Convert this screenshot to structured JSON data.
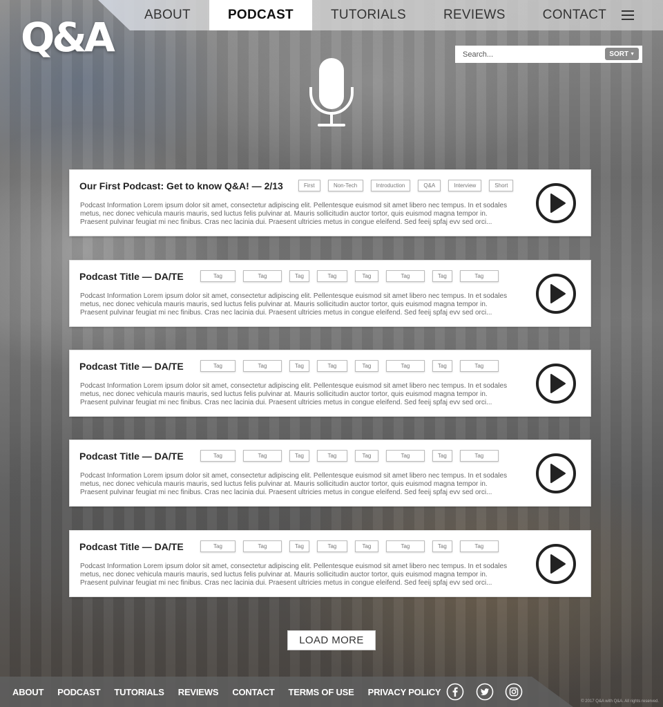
{
  "nav": {
    "items": [
      {
        "label": "ABOUT"
      },
      {
        "label": "PODCAST",
        "active": true
      },
      {
        "label": "TUTORIALS"
      },
      {
        "label": "REVIEWS"
      },
      {
        "label": "CONTACT"
      }
    ],
    "menu_icon": "hamburger-icon"
  },
  "logo": {
    "text": "Q&A"
  },
  "search": {
    "placeholder": "Search...",
    "sort_label": "SORT"
  },
  "hero_icon": "microphone-icon",
  "podcasts": [
    {
      "title": "Our First Podcast: Get to know Q&A! — 2/13",
      "tags": [
        "First",
        "Non-Tech",
        "Introduction",
        "Q&A",
        "Interview",
        "Short"
      ],
      "description": "Podcast Information Lorem ipsum dolor sit amet, consectetur adipiscing elit. Pellentesque euismod sit amet libero nec tempus. In et sodales metus, nec donec vehicula mauris mauris, sed luctus felis pulvinar at. Mauris sollicitudin auctor tortor, quis euismod magna tempor in. Praesent pulvinar feugiat mi nec finibus. Cras nec lacinia dui. Praesent ultricies metus in congue eleifend. Sed feeij spfaj evv sed orci..."
    },
    {
      "title": "Podcast Title — DA/TE",
      "tags": [
        "Tag",
        "Tag",
        "Tag",
        "Tag",
        "Tag",
        "Tag",
        "Tag",
        "Tag"
      ],
      "description": "Podcast Information Lorem ipsum dolor sit amet, consectetur adipiscing elit. Pellentesque euismod sit amet libero nec tempus. In et sodales metus, nec donec vehicula mauris mauris, sed luctus felis pulvinar at. Mauris sollicitudin auctor tortor, quis euismod magna tempor in. Praesent pulvinar feugiat mi nec finibus. Cras nec lacinia dui. Praesent ultricies metus in congue eleifend. Sed feeij spfaj evv sed orci..."
    },
    {
      "title": "Podcast Title — DA/TE",
      "tags": [
        "Tag",
        "Tag",
        "Tag",
        "Tag",
        "Tag",
        "Tag",
        "Tag",
        "Tag"
      ],
      "description": "Podcast Information Lorem ipsum dolor sit amet, consectetur adipiscing elit. Pellentesque euismod sit amet libero nec tempus. In et sodales metus, nec donec vehicula mauris mauris, sed luctus felis pulvinar at. Mauris sollicitudin auctor tortor, quis euismod magna tempor in. Praesent pulvinar feugiat mi nec finibus. Cras nec lacinia dui. Praesent ultricies metus in congue eleifend. Sed feeij spfaj evv sed orci..."
    },
    {
      "title": "Podcast Title — DA/TE",
      "tags": [
        "Tag",
        "Tag",
        "Tag",
        "Tag",
        "Tag",
        "Tag",
        "Tag",
        "Tag"
      ],
      "description": "Podcast Information Lorem ipsum dolor sit amet, consectetur adipiscing elit. Pellentesque euismod sit amet libero nec tempus. In et sodales metus, nec donec vehicula mauris mauris, sed luctus felis pulvinar at. Mauris sollicitudin auctor tortor, quis euismod magna tempor in. Praesent pulvinar feugiat mi nec finibus. Cras nec lacinia dui. Praesent ultricies metus in congue eleifend. Sed feeij spfaj evv sed orci..."
    },
    {
      "title": "Podcast Title — DA/TE",
      "tags": [
        "Tag",
        "Tag",
        "Tag",
        "Tag",
        "Tag",
        "Tag",
        "Tag",
        "Tag"
      ],
      "description": "Podcast Information Lorem ipsum dolor sit amet, consectetur adipiscing elit. Pellentesque euismod sit amet libero nec tempus. In et sodales metus, nec donec vehicula mauris mauris, sed luctus felis pulvinar at. Mauris sollicitudin auctor tortor, quis euismod magna tempor in. Praesent pulvinar feugiat mi nec finibus. Cras nec lacinia dui. Praesent ultricies metus in congue eleifend. Sed feeij spfaj evv sed orci..."
    }
  ],
  "load_more_label": "LOAD MORE",
  "footer": {
    "links": [
      "ABOUT",
      "PODCAST",
      "TUTORIALS",
      "REVIEWS",
      "CONTACT",
      "TERMS OF USE",
      "PRIVACY POLICY"
    ],
    "social_icons": [
      "facebook-icon",
      "twitter-icon",
      "instagram-icon"
    ],
    "copyright": "© 2017 Q&A with Q&A. All rights reserved."
  },
  "colors": {
    "accent": "#ffffff",
    "nav_band": "#d0d0d0",
    "footer_band": "#5f5f5f",
    "text": "#222222"
  }
}
